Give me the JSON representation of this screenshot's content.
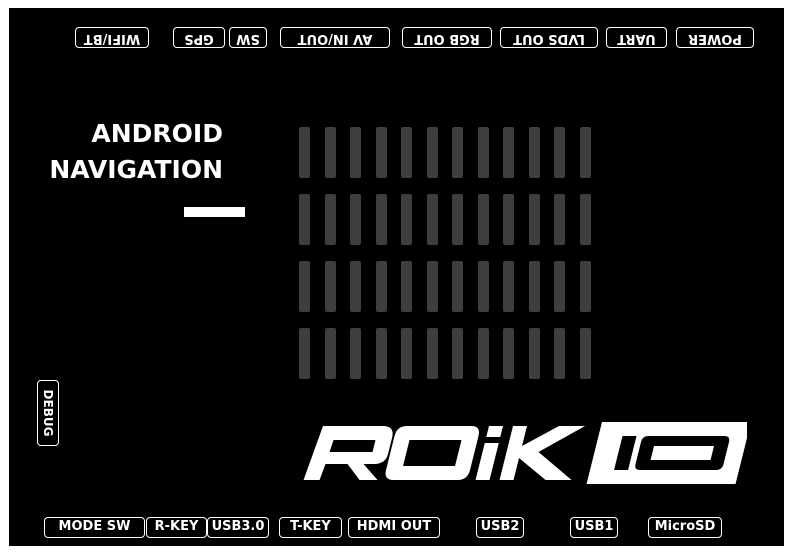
{
  "top_ports": [
    {
      "id": "wifi-bt",
      "label": "WIFI/BT"
    },
    {
      "id": "gps",
      "label": "GPS"
    },
    {
      "id": "sw",
      "label": "SW"
    },
    {
      "id": "av-in-out",
      "label": "AV IN/OUT"
    },
    {
      "id": "rgb-out",
      "label": "RGB OUT"
    },
    {
      "id": "lvds-out",
      "label": "LVDS OUT"
    },
    {
      "id": "uart",
      "label": "UART"
    },
    {
      "id": "power",
      "label": "POWER"
    }
  ],
  "bottom_ports": [
    {
      "id": "mode-sw",
      "label": "MODE SW"
    },
    {
      "id": "r-key",
      "label": "R-KEY"
    },
    {
      "id": "usb3",
      "label": "USB3.0"
    },
    {
      "id": "t-key",
      "label": "T-KEY"
    },
    {
      "id": "hdmi-out",
      "label": "HDMI OUT"
    },
    {
      "id": "usb2",
      "label": "USB2"
    },
    {
      "id": "usb1",
      "label": "USB1"
    },
    {
      "id": "microsd",
      "label": "MicroSD"
    }
  ],
  "side_port": {
    "label": "DEBUG"
  },
  "title": {
    "line1": "ANDROID",
    "line2": "NAVIGATION"
  },
  "logo": {
    "brand": "ROiK",
    "model": "10"
  },
  "colors": {
    "board": "#000000",
    "text": "#ffffff",
    "slot": "#3e3e3e"
  }
}
